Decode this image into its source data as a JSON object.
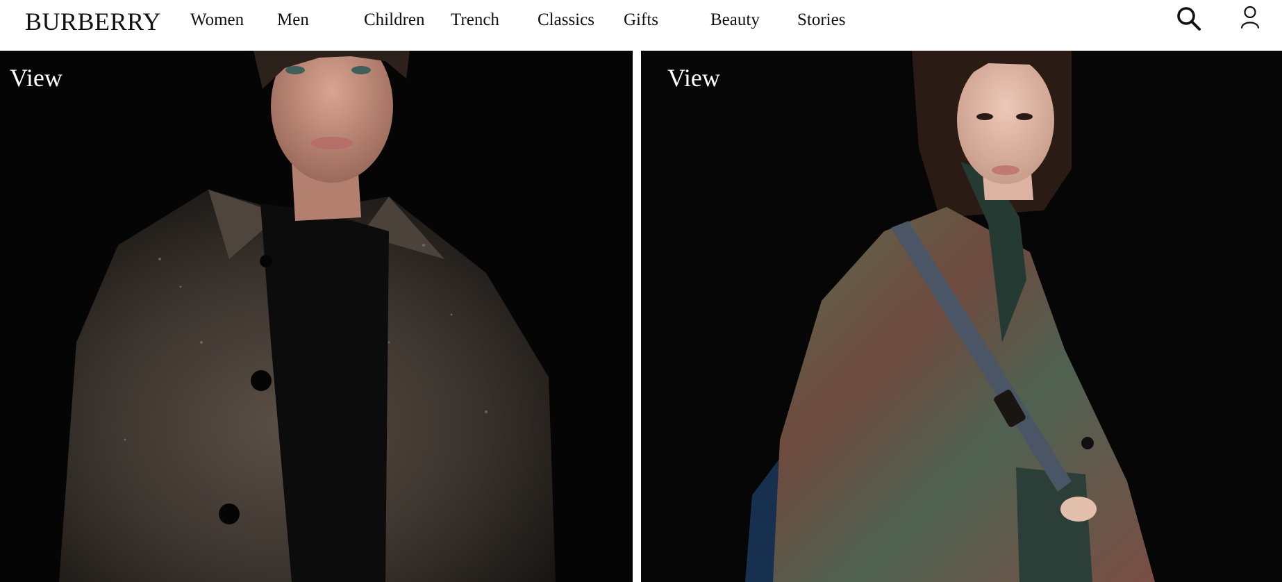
{
  "header": {
    "logo": "BURBERRY",
    "nav": [
      {
        "label": "Women"
      },
      {
        "label": "Men"
      },
      {
        "label": "Children"
      },
      {
        "label": "Trench"
      },
      {
        "label": "Classics"
      },
      {
        "label": "Gifts"
      },
      {
        "label": "Beauty"
      },
      {
        "label": "Stories"
      }
    ],
    "icons": {
      "search": "search-icon",
      "account": "user-icon"
    }
  },
  "panels": [
    {
      "cta": "View",
      "image": "model-dark-trench-coat-photo"
    },
    {
      "cta": "View",
      "image": "model-iridescent-trench-coat-photo"
    }
  ],
  "colors": {
    "header_bg": "#ffffff",
    "text_dark": "#111111",
    "panel_bg": "#050505",
    "cta_text": "#ffffff"
  }
}
